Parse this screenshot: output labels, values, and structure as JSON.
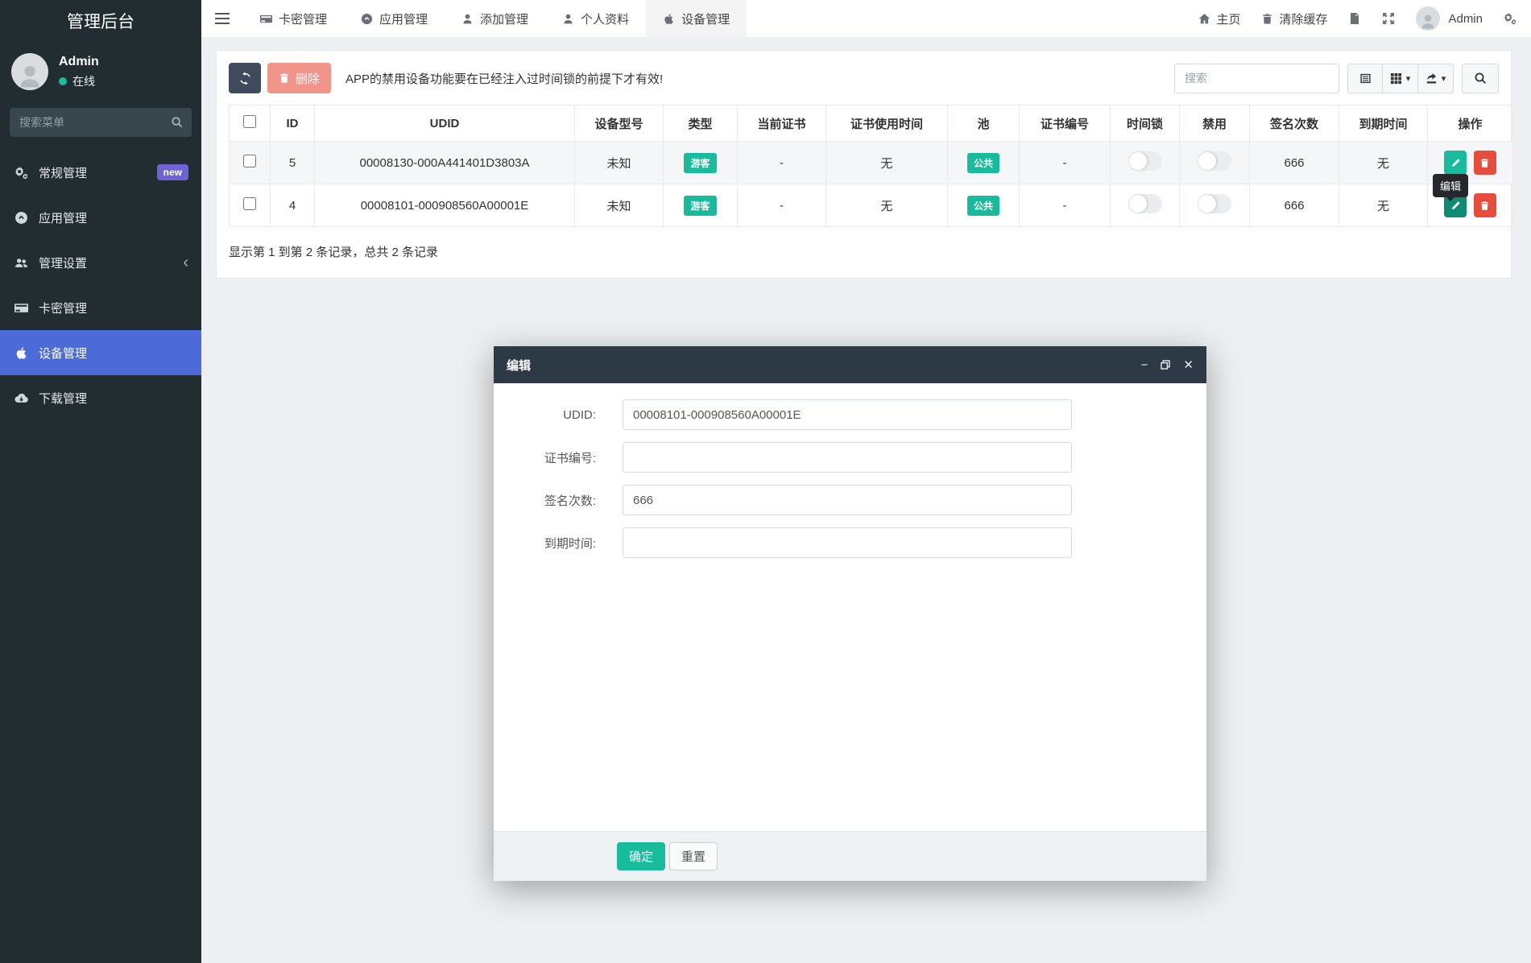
{
  "app": {
    "title": "管理后台"
  },
  "sidebar": {
    "user": {
      "name": "Admin",
      "status": "在线"
    },
    "search_placeholder": "搜索菜单",
    "items": [
      {
        "label": "常规管理",
        "icon": "gears-icon",
        "badge": "new"
      },
      {
        "label": "应用管理",
        "icon": "app-circle-icon"
      },
      {
        "label": "管理设置",
        "icon": "users-icon",
        "chevron": "‹"
      },
      {
        "label": "卡密管理",
        "icon": "credit-card-icon"
      },
      {
        "label": "设备管理",
        "icon": "apple-icon",
        "active": true
      },
      {
        "label": "下载管理",
        "icon": "cloud-download-icon"
      }
    ]
  },
  "topbar": {
    "tabs": [
      {
        "label": "卡密管理",
        "icon": "credit-card-icon"
      },
      {
        "label": "应用管理",
        "icon": "app-circle-icon"
      },
      {
        "label": "添加管理",
        "icon": "user-icon"
      },
      {
        "label": "个人资料",
        "icon": "user-icon"
      },
      {
        "label": "设备管理",
        "icon": "apple-icon",
        "active": true
      }
    ],
    "right": {
      "home": "主页",
      "clear_cache": "清除缓存",
      "user": "Admin",
      "icons": [
        "doc-icon",
        "fullscreen-icon",
        "gears-icon"
      ]
    }
  },
  "toolbar": {
    "delete_label": "删除",
    "notice": "APP的禁用设备功能要在已经注入过时间锁的前提下才有效!",
    "search_placeholder": "搜索"
  },
  "table": {
    "headers": {
      "id": "ID",
      "udid": "UDID",
      "model": "设备型号",
      "type": "类型",
      "cert": "当前证书",
      "cert_time": "证书使用时间",
      "pool": "池",
      "cert_no": "证书编号",
      "time_lock": "时间锁",
      "disabled": "禁用",
      "sign_count": "签名次数",
      "expire": "到期时间",
      "ops": "操作"
    },
    "rows": [
      {
        "id": "5",
        "udid": "00008130-000A441401D3803A",
        "model": "未知",
        "type": "游客",
        "cert": "-",
        "cert_time": "无",
        "pool": "公共",
        "cert_no": "-",
        "time_lock_on": false,
        "disabled_on": false,
        "sign_count": "666",
        "expire": "无"
      },
      {
        "id": "4",
        "udid": "00008101-000908560A00001E",
        "model": "未知",
        "type": "游客",
        "cert": "-",
        "cert_time": "无",
        "pool": "公共",
        "cert_no": "-",
        "time_lock_on": false,
        "disabled_on": false,
        "sign_count": "666",
        "expire": "无"
      }
    ],
    "summary": "显示第 1 到第 2 条记录，总共 2 条记录",
    "edit_tooltip": "编辑"
  },
  "modal": {
    "title": "编辑",
    "fields": [
      {
        "label": "UDID:",
        "value": "00008101-000908560A00001E"
      },
      {
        "label": "证书编号:",
        "value": ""
      },
      {
        "label": "签名次数:",
        "value": "666"
      },
      {
        "label": "到期时间:",
        "value": ""
      }
    ],
    "ok_label": "确定",
    "reset_label": "重置"
  },
  "colors": {
    "sidebar_bg": "#222d32",
    "sidebar_active": "#4c6bd8",
    "badge_purple": "#6e63d4",
    "green": "#18bc9c",
    "red": "#e74c3c",
    "salmon": "#f1948a",
    "dark_button": "#3f4a5c",
    "modal_header": "#2d3a46",
    "online_dot": "#1abc9c"
  }
}
